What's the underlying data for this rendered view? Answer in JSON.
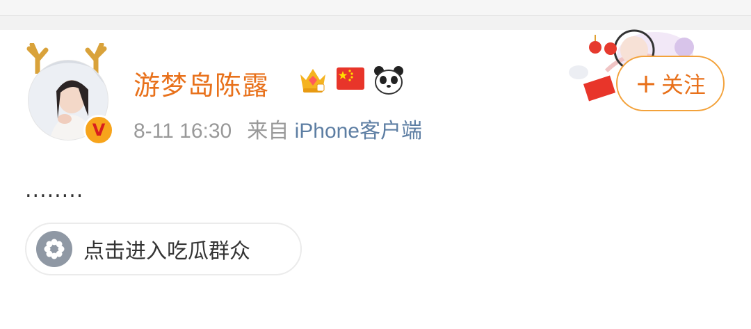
{
  "post": {
    "username": "游梦岛陈露",
    "time": "8-11 16:30",
    "source_prefix": "来自",
    "source": "iPhone客户端",
    "follow_label": "关注",
    "content": "........",
    "topic_chip": "点击进入吃瓜群众"
  },
  "icons": {
    "verified": "V",
    "badges": [
      "crown-vip-icon",
      "china-flag-icon",
      "panda-icon"
    ],
    "topic": "flower-icon"
  },
  "colors": {
    "username": "#e8711b",
    "source_link": "#5d7ea3",
    "follow_border": "#f3a23b"
  }
}
